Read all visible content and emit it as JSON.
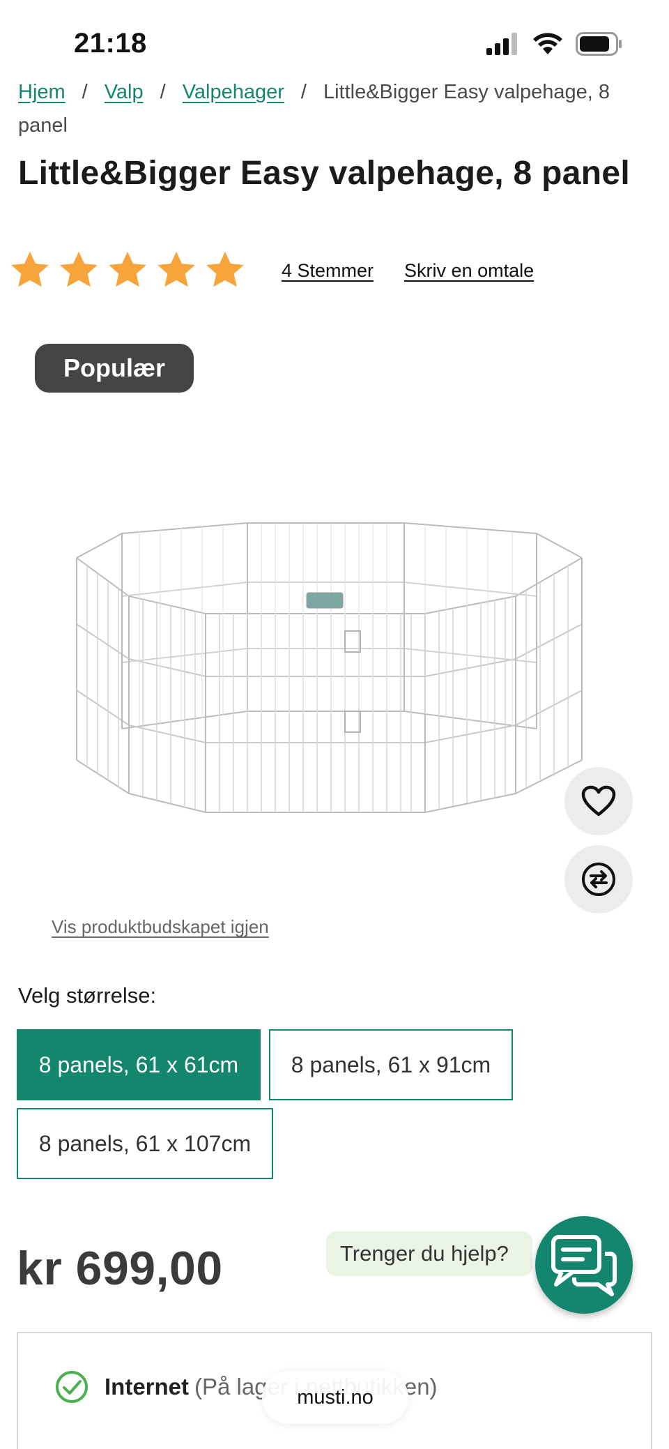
{
  "status_bar": {
    "time": "21:18"
  },
  "breadcrumb": {
    "items": [
      "Hjem",
      "Valp",
      "Valpehager"
    ],
    "separator": "/",
    "current": "Little&Bigger Easy valpehage, 8 panel"
  },
  "product": {
    "title": "Little&Bigger Easy valpehage, 8 panel",
    "rating": {
      "stars": 5,
      "max": 5,
      "votes_label": "4 Stemmer",
      "review_label": "Skriv en omtale",
      "star_color": "#f7a43a"
    },
    "badge": "Populær",
    "show_message_label": "Vis produktbudskapet igjen",
    "size_label": "Velg størrelse:",
    "sizes": [
      {
        "label": "8 panels, 61 x 61cm",
        "selected": true
      },
      {
        "label": "8 panels, 61 x 91cm",
        "selected": false
      },
      {
        "label": "8 panels, 61 x 107cm",
        "selected": false
      }
    ],
    "price": "kr 699,00"
  },
  "actions": {
    "favorite_icon": "heart-icon",
    "compare_icon": "compare-icon"
  },
  "help": {
    "bubble_text": "Trenger du hjelp?",
    "chat_icon": "chat-icon"
  },
  "availability": {
    "channel": "Internet",
    "detail": "(På lager i nettbutikken)"
  },
  "browser": {
    "url": "musti.no"
  },
  "colors": {
    "brand_green": "#14866d",
    "badge_bg": "#444444",
    "help_bubble_bg": "#e9f4e4"
  }
}
